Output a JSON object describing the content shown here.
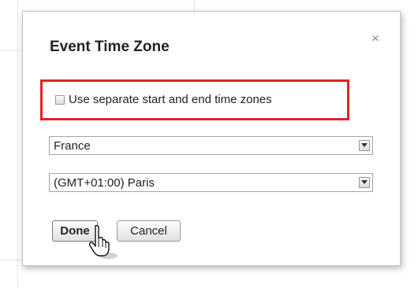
{
  "dialog": {
    "title": "Event Time Zone",
    "close_glyph": "×",
    "close_icon": "close-icon",
    "checkbox": {
      "label": "Use separate start and end time zones",
      "checked": false
    },
    "highlight_color": "#e02424",
    "country_select": {
      "value": "France",
      "arrow_icon": "dropdown-arrow-icon"
    },
    "timezone_select": {
      "value": "(GMT+01:00) Paris",
      "arrow_icon": "dropdown-arrow-icon"
    },
    "buttons": {
      "done_label": "Done",
      "cancel_label": "Cancel"
    },
    "cursor_icon": "hand-pointer-icon"
  }
}
